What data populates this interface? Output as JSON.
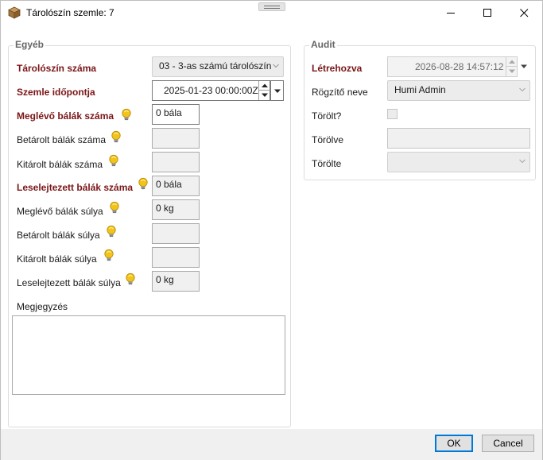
{
  "window": {
    "title": "Tárolószín szemle: 7",
    "icons": {
      "app": "box-icon",
      "minimize": "minimize-icon",
      "maximize": "maximize-icon",
      "close": "close-icon"
    }
  },
  "egyeb": {
    "legend": "Egyéb",
    "tarolo_label": "Tárolószín száma",
    "tarolo_value": "03 - 3-as számú tárolószín",
    "szemle_label": "Szemle időpontja",
    "szemle_value": "2025-01-23 00:00:00Z",
    "meglevo_balak_label": "Meglévő bálák száma",
    "meglevo_balak_value": "0 bála",
    "betarolt_balak_label": "Betárolt bálák száma",
    "betarolt_balak_value": "",
    "kitarolt_balak_label": "Kitárolt bálák száma",
    "kitarolt_balak_value": "",
    "leselejtezett_balak_label": "Leselejtezett bálák száma",
    "leselejtezett_balak_value": "0 bála",
    "meglevo_suly_label": "Meglévő bálák súlya",
    "meglevo_suly_value": "0 kg",
    "betarolt_suly_label": "Betárolt bálák súlya",
    "betarolt_suly_value": "",
    "kitarolt_suly_label": "Kitárolt bálák súlya",
    "kitarolt_suly_value": "",
    "leselejtezett_suly_label": "Leselejtezett bálák súlya",
    "leselejtezett_suly_value": "0 kg",
    "megjegyzes_label": "Megjegyzés",
    "megjegyzes_value": ""
  },
  "audit": {
    "legend": "Audit",
    "letrehozva_label": "Létrehozva",
    "letrehozva_value": "2026-08-28 14:57:12",
    "rogzito_label": "Rögzítő neve",
    "rogzito_value": "Humi Admin",
    "torolt_label": "Törölt?",
    "torolt_checked": false,
    "torolve_label": "Törölve",
    "torolve_value": "",
    "torolte_label": "Törölte",
    "torolte_value": ""
  },
  "footer": {
    "ok_label": "OK",
    "cancel_label": "Cancel"
  },
  "colors": {
    "required_label": "#7a1517",
    "accent": "#0078d7",
    "hint_bulb": "#f2c318"
  }
}
